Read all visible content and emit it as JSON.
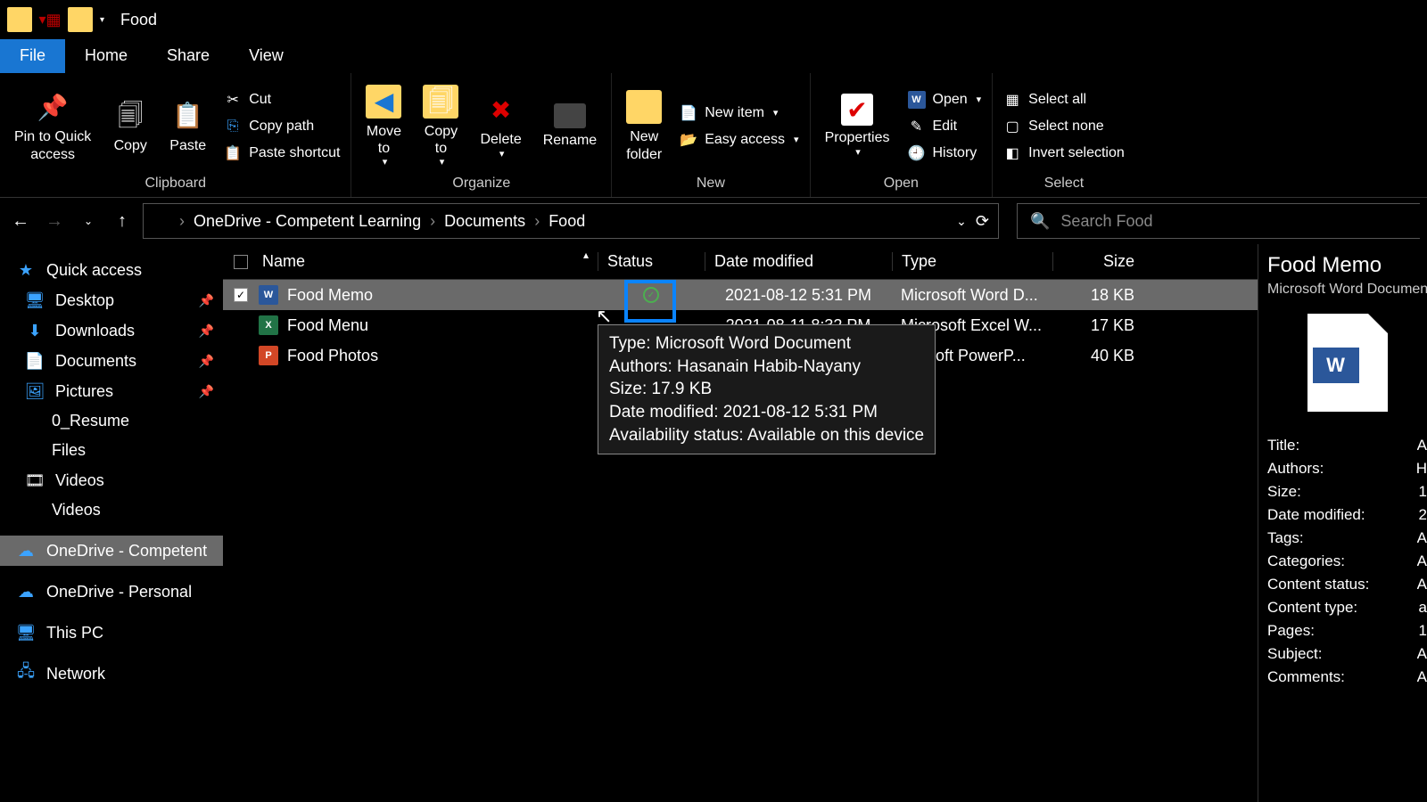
{
  "window": {
    "title": "Food"
  },
  "tabs": {
    "file": "File",
    "home": "Home",
    "share": "Share",
    "view": "View"
  },
  "ribbon": {
    "pin": "Pin to Quick\naccess",
    "copy": "Copy",
    "paste": "Paste",
    "cut": "Cut",
    "copypath": "Copy path",
    "pasteshortcut": "Paste shortcut",
    "moveto": "Move\nto",
    "copyto": "Copy\nto",
    "delete": "Delete",
    "rename": "Rename",
    "newfolder": "New\nfolder",
    "newitem": "New item",
    "easyaccess": "Easy access",
    "properties": "Properties",
    "open": "Open",
    "edit": "Edit",
    "history": "History",
    "selectall": "Select all",
    "selectnone": "Select none",
    "invert": "Invert selection",
    "groups": {
      "clipboard": "Clipboard",
      "organize": "Organize",
      "new": "New",
      "open": "Open",
      "select": "Select"
    }
  },
  "breadcrumb": {
    "a": "OneDrive - Competent Learning",
    "b": "Documents",
    "c": "Food"
  },
  "search": {
    "placeholder": "Search Food"
  },
  "columns": {
    "name": "Name",
    "status": "Status",
    "date": "Date modified",
    "type": "Type",
    "size": "Size"
  },
  "files": [
    {
      "name": "Food Memo",
      "date": "2021-08-12 5:31 PM",
      "type": "Microsoft Word D...",
      "size": "18 KB",
      "icon": "word",
      "selected": true,
      "status": "check"
    },
    {
      "name": "Food Menu",
      "date": "2021-08-11 8:32 PM",
      "type": "Microsoft Excel W...",
      "size": "17 KB",
      "icon": "excel",
      "selected": false,
      "status": ""
    },
    {
      "name": "Food Photos",
      "date": "",
      "type": "osoft PowerP...",
      "size": "40 KB",
      "icon": "ppt",
      "selected": false,
      "status": "cloud"
    }
  ],
  "tooltip": {
    "l1": "Type: Microsoft Word Document",
    "l2": "Authors: Hasanain Habib-Nayany",
    "l3": "Size: 17.9 KB",
    "l4": "Date modified: 2021-08-12 5:31 PM",
    "l5": "Availability status: Available on this device"
  },
  "sidebar": {
    "quickaccess": "Quick access",
    "desktop": "Desktop",
    "downloads": "Downloads",
    "documents": "Documents",
    "pictures": "Pictures",
    "resume": "0_Resume",
    "files": "Files",
    "videos1": "Videos",
    "videos2": "Videos",
    "onedrive_comp": "OneDrive - Competent",
    "onedrive_pers": "OneDrive - Personal",
    "thispc": "This PC",
    "network": "Network"
  },
  "details": {
    "title": "Food Memo",
    "subtype": "Microsoft Word Document",
    "props": {
      "Title": "A",
      "Authors": "H",
      "Size": "1",
      "Date_modified": "2",
      "Tags": "A",
      "Categories": "A",
      "Content_status": "A",
      "Content_type": "a",
      "Pages": "1",
      "Subject": "A",
      "Comments": "A"
    },
    "labels": {
      "Title": "Title:",
      "Authors": "Authors:",
      "Size": "Size:",
      "Date_modified": "Date modified:",
      "Tags": "Tags:",
      "Categories": "Categories:",
      "Content_status": "Content status:",
      "Content_type": "Content type:",
      "Pages": "Pages:",
      "Subject": "Subject:",
      "Comments": "Comments:"
    }
  }
}
